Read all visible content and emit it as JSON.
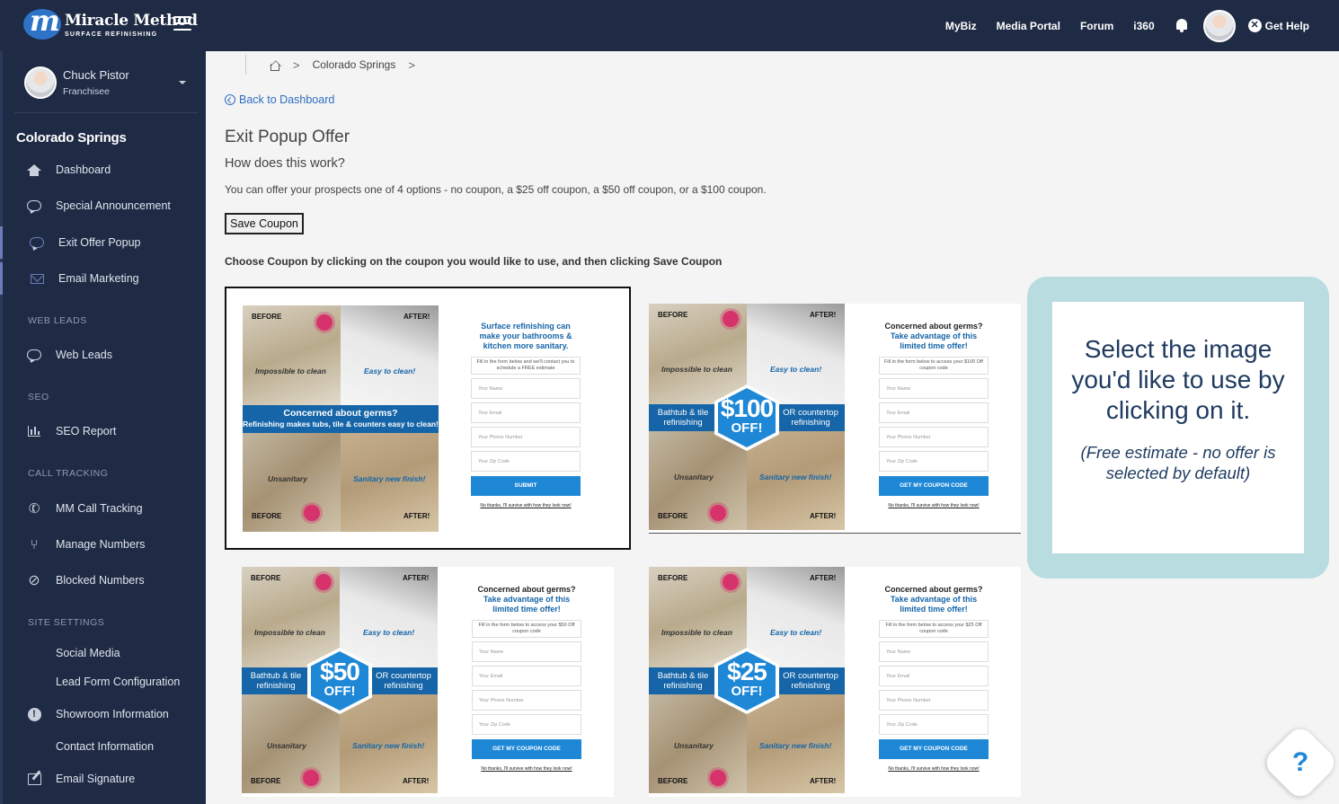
{
  "brand": {
    "name": "Miracle Method",
    "tagline": "SURFACE REFINISHING"
  },
  "topnav": {
    "links": [
      "MyBiz",
      "Media Portal",
      "Forum",
      "i360"
    ],
    "help_label": "Get Help"
  },
  "user": {
    "name": "Chuck Pistor",
    "role": "Franchisee"
  },
  "sidebar": {
    "site_title": "Colorado Springs",
    "items": [
      {
        "label": "Dashboard",
        "icon": "home-icon"
      },
      {
        "label": "Special Announcement",
        "icon": "chat-icon"
      },
      {
        "label": "Exit Offer Popup",
        "icon": "chat-icon"
      },
      {
        "label": "Email Marketing",
        "icon": "envelope-icon"
      }
    ],
    "section_web_leads": "WEB LEADS",
    "web_leads": {
      "label": "Web Leads",
      "icon": "chat-icon"
    },
    "section_seo": "SEO",
    "seo_report": {
      "label": "SEO Report",
      "icon": "bar-chart-icon"
    },
    "section_call_tracking": "CALL TRACKING",
    "call_items": [
      {
        "label": "MM Call Tracking",
        "icon": "phone-icon"
      },
      {
        "label": "Manage Numbers",
        "icon": "branch-icon"
      },
      {
        "label": "Blocked Numbers",
        "icon": "phone-blocked-icon"
      }
    ],
    "section_site_settings": "SITE SETTINGS",
    "settings_items": [
      {
        "label": "Social Media"
      },
      {
        "label": "Lead Form Configuration"
      },
      {
        "label": "Showroom Information",
        "icon": "alert-icon"
      },
      {
        "label": "Contact Information"
      },
      {
        "label": "Email Signature",
        "icon": "edit-icon"
      }
    ]
  },
  "breadcrumb": {
    "current": "Colorado Springs"
  },
  "main": {
    "back_link": "Back to Dashboard",
    "title": "Exit Popup Offer",
    "subtitle": "How does this work?",
    "description": "You can offer your prospects one of 4 options - no coupon, a $25 off coupon, a $50 off coupon, or a $100 coupon.",
    "save_button": "Save Coupon",
    "instruction": "Choose Coupon by clicking on the coupon you would like to use, and then clicking Save Coupon"
  },
  "coupon_common": {
    "before": "BEFORE",
    "after": "AFTER!",
    "impossible": "Impossible to clean",
    "easy": "Easy to clean!",
    "unsanitary": "Unsanitary",
    "sanitary": "Sanitary new finish!",
    "side_left": "Bathtub & tile refinishing",
    "side_right": "OR countertop refinishing",
    "field_name": "Your Name",
    "field_email": "Your Email",
    "field_phone": "Your Phone Number",
    "field_zip": "Your Zip Code",
    "no_thanks": "No thanks, I'll survive with how they look now!",
    "offer_head_1": "Concerned about germs?",
    "offer_head_2": "Take advantage of this limited time offer!",
    "offer_button": "GET MY COUPON CODE",
    "off": "OFF!"
  },
  "coupons": [
    {
      "band_title": "Concerned about germs?",
      "band_sub": "Refinishing makes tubs, tile & counters easy to clean!",
      "form_head": "Surface refinishing can make your bathrooms & kitchen more sanitary.",
      "note": "Fill in the form below and we'll contact you to schedule a FREE estimate",
      "button": "SUBMIT"
    },
    {
      "amount": "$100",
      "note": "Fill in the form below to access your $100 Off coupon code"
    },
    {
      "amount": "$50",
      "note": "Fill in the form below to access your $50 Off coupon code"
    },
    {
      "amount": "$25",
      "note": "Fill in the form below to access your $25 Off coupon code"
    }
  ],
  "callout": {
    "main": "Select the image you'd like to use by clicking on it.",
    "note": "(Free estimate - no offer is selected by default)"
  },
  "help_fab": "?"
}
